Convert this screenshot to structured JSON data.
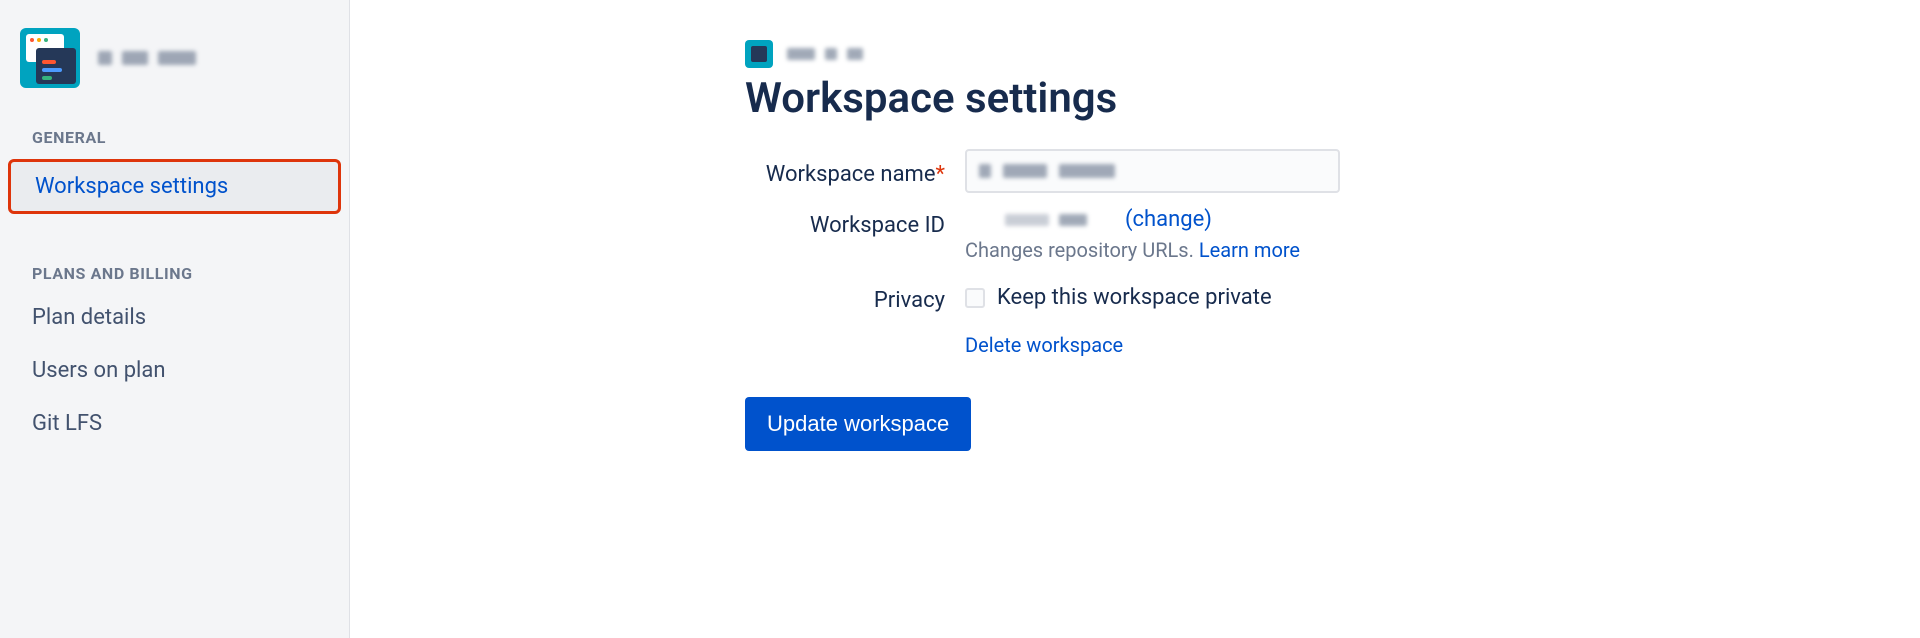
{
  "sidebar": {
    "section_general": "GENERAL",
    "section_plans": "PLANS AND BILLING",
    "items": {
      "workspace_settings": "Workspace settings",
      "plan_details": "Plan details",
      "users_on_plan": "Users on plan",
      "git_lfs": "Git LFS"
    }
  },
  "page": {
    "title": "Workspace settings"
  },
  "form": {
    "name_label": "Workspace name",
    "id_label": "Workspace ID",
    "change_link": "(change)",
    "url_help_prefix": "Changes repository URLs. ",
    "learn_more": "Learn more",
    "privacy_label": "Privacy",
    "privacy_checkbox": "Keep this workspace private",
    "delete_link": "Delete workspace",
    "submit": "Update workspace"
  }
}
